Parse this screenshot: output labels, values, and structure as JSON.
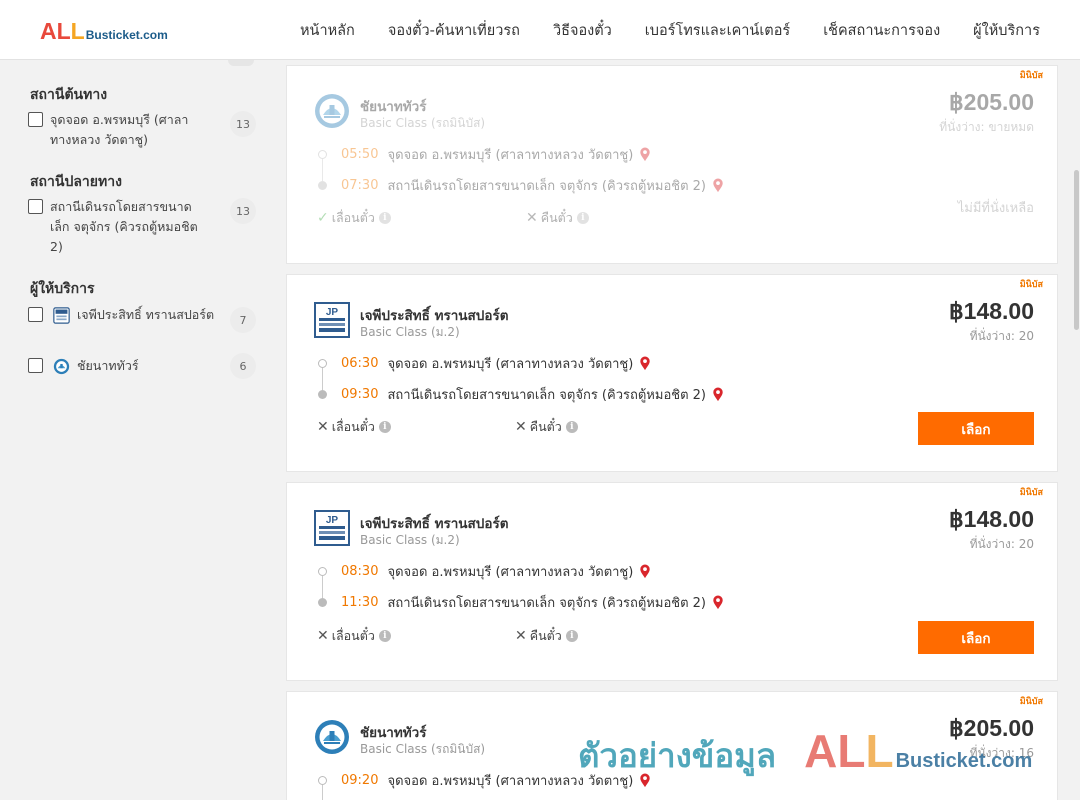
{
  "header": {
    "logo_all_a": "AL",
    "logo_all_b": "L",
    "logo_site": "Busticket.com",
    "nav": [
      "หน้าหลัก",
      "จองตั๋ว-ค้นหาเที่ยวรถ",
      "วิธีจองตั๋ว",
      "เบอร์โทรและเคาน์เตอร์",
      "เช็คสถานะการจอง",
      "ผู้ให้บริการ"
    ]
  },
  "sidebar": {
    "origin_title": "สถานีต้นทาง",
    "origin_items": [
      {
        "label": "จุดจอด อ.พรหมบุรี (ศาลาทางหลวง วัดตาชู)",
        "count": "13"
      }
    ],
    "dest_title": "สถานีปลายทาง",
    "dest_items": [
      {
        "label": "สถานีเดินรถโดยสารขนาดเล็ก จตุจักร (คิวรถตู้หมอชิต 2)",
        "count": "13"
      }
    ],
    "operator_title": "ผู้ให้บริการ",
    "operator_items": [
      {
        "label": "เจพีประสิทธิ์ ทรานสปอร์ต",
        "count": "7"
      },
      {
        "label": "ชัยนาททัวร์",
        "count": "6"
      }
    ]
  },
  "trips": [
    {
      "badge": "มินิบัส",
      "operator": "ชัยนาททัวร์",
      "class": "Basic Class (รถมินิบัส)",
      "price": "฿205.00",
      "seats": "ที่นั่งว่าง: ขายหมด",
      "depart_time": "05:50",
      "depart_stop": "จุดจอด อ.พรหมบุรี (ศาลาทางหลวง วัดตาชู)",
      "arrive_time": "07:30",
      "arrive_stop": "สถานีเดินรถโดยสารขนาดเล็ก จตุจักร (คิวรถตู้หมอชิต 2)",
      "reschedule": "เลื่อนตั๋ว",
      "refund": "คืนตั๋ว",
      "status": "ไม่มีที่นั่งเหลือ"
    },
    {
      "badge": "มินิบัส",
      "operator": "เจพีประสิทธิ์ ทรานสปอร์ต",
      "class": "Basic Class (ม.2)",
      "price": "฿148.00",
      "seats": "ที่นั่งว่าง: 20",
      "depart_time": "06:30",
      "depart_stop": "จุดจอด อ.พรหมบุรี (ศาลาทางหลวง วัดตาชู)",
      "arrive_time": "09:30",
      "arrive_stop": "สถานีเดินรถโดยสารขนาดเล็ก จตุจักร (คิวรถตู้หมอชิต 2)",
      "reschedule": "เลื่อนตั๋ว",
      "refund": "คืนตั๋ว",
      "select": "เลือก"
    },
    {
      "badge": "มินิบัส",
      "operator": "เจพีประสิทธิ์ ทรานสปอร์ต",
      "class": "Basic Class (ม.2)",
      "price": "฿148.00",
      "seats": "ที่นั่งว่าง: 20",
      "depart_time": "08:30",
      "depart_stop": "จุดจอด อ.พรหมบุรี (ศาลาทางหลวง วัดตาชู)",
      "arrive_time": "11:30",
      "arrive_stop": "สถานีเดินรถโดยสารขนาดเล็ก จตุจักร (คิวรถตู้หมอชิต 2)",
      "reschedule": "เลื่อนตั๋ว",
      "refund": "คืนตั๋ว",
      "select": "เลือก"
    },
    {
      "badge": "มินิบัส",
      "operator": "ชัยนาททัวร์",
      "class": "Basic Class (รถมินิบัส)",
      "price": "฿205.00",
      "seats": "ที่นั่งว่าง: 16",
      "depart_time": "09:20",
      "depart_stop": "จุดจอด อ.พรหมบุรี (ศาลาทางหลวง วัดตาชู)"
    }
  ],
  "watermark": {
    "text": "ตัวอย่างข้อมูล",
    "all_a": "AL",
    "all_b": "L",
    "site": "Busticket.com"
  },
  "colors": {
    "accent_orange": "#ff6b00",
    "time_orange": "#f07800",
    "pin_red": "#d9262c",
    "check_green": "#4caf50"
  }
}
